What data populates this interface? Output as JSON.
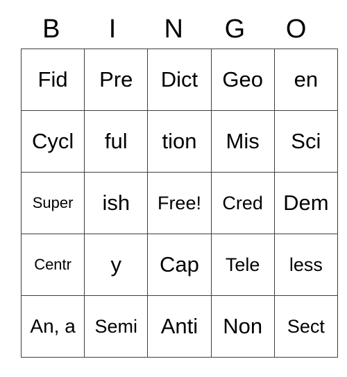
{
  "card": {
    "title": "BINGO",
    "headers": [
      "B",
      "I",
      "N",
      "G",
      "O"
    ],
    "free_space_label": "Free!",
    "colors": {
      "background": "#ffffff",
      "border": "#3d3d3d",
      "text": "#000000"
    },
    "rows": [
      [
        "Fid",
        "Pre",
        "Dict",
        "Geo",
        "en"
      ],
      [
        "Cycl",
        "ful",
        "tion",
        "Mis",
        "Sci"
      ],
      [
        "Super",
        "ish",
        "Free!",
        "Cred",
        "Dem"
      ],
      [
        "Centr",
        "y",
        "Cap",
        "Tele",
        "less"
      ],
      [
        "An, a",
        "Semi",
        "Anti",
        "Non",
        "Sect"
      ]
    ]
  }
}
